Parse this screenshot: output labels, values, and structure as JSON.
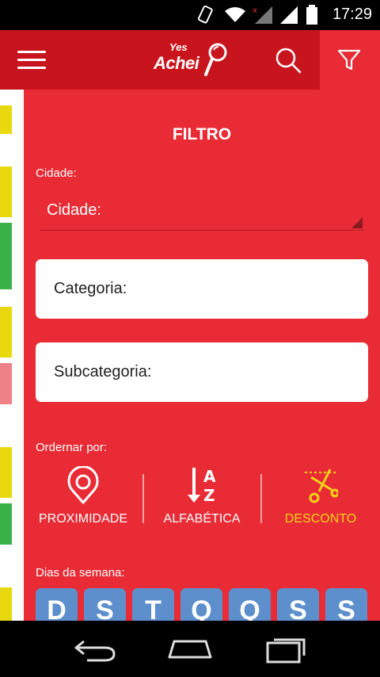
{
  "status_bar": {
    "time": "17:29"
  },
  "header": {
    "logo_top": "Yes",
    "logo_bottom": "Achei"
  },
  "filter": {
    "title": "FILTRO",
    "city_label": "Cidade:",
    "city_value": "Cidade:",
    "category_value": "Categoria:",
    "subcategory_value": "Subcategoria:",
    "sort_label": "Ordernar por:",
    "sort_options": [
      {
        "label": "PROXIMIDADE",
        "color": "#ffffff"
      },
      {
        "label": "ALFABÉTICA",
        "color": "#ffffff"
      },
      {
        "label": "DESCONTO",
        "color": "#f5d31a"
      }
    ],
    "days_label": "Dias da semana:",
    "days": [
      "D",
      "S",
      "T",
      "Q",
      "Q",
      "S",
      "S"
    ]
  },
  "colors": {
    "header_red": "#c8151d",
    "panel_red": "#e82b35",
    "day_blue": "#5d8fcc",
    "highlight_yellow": "#f5d31a"
  }
}
